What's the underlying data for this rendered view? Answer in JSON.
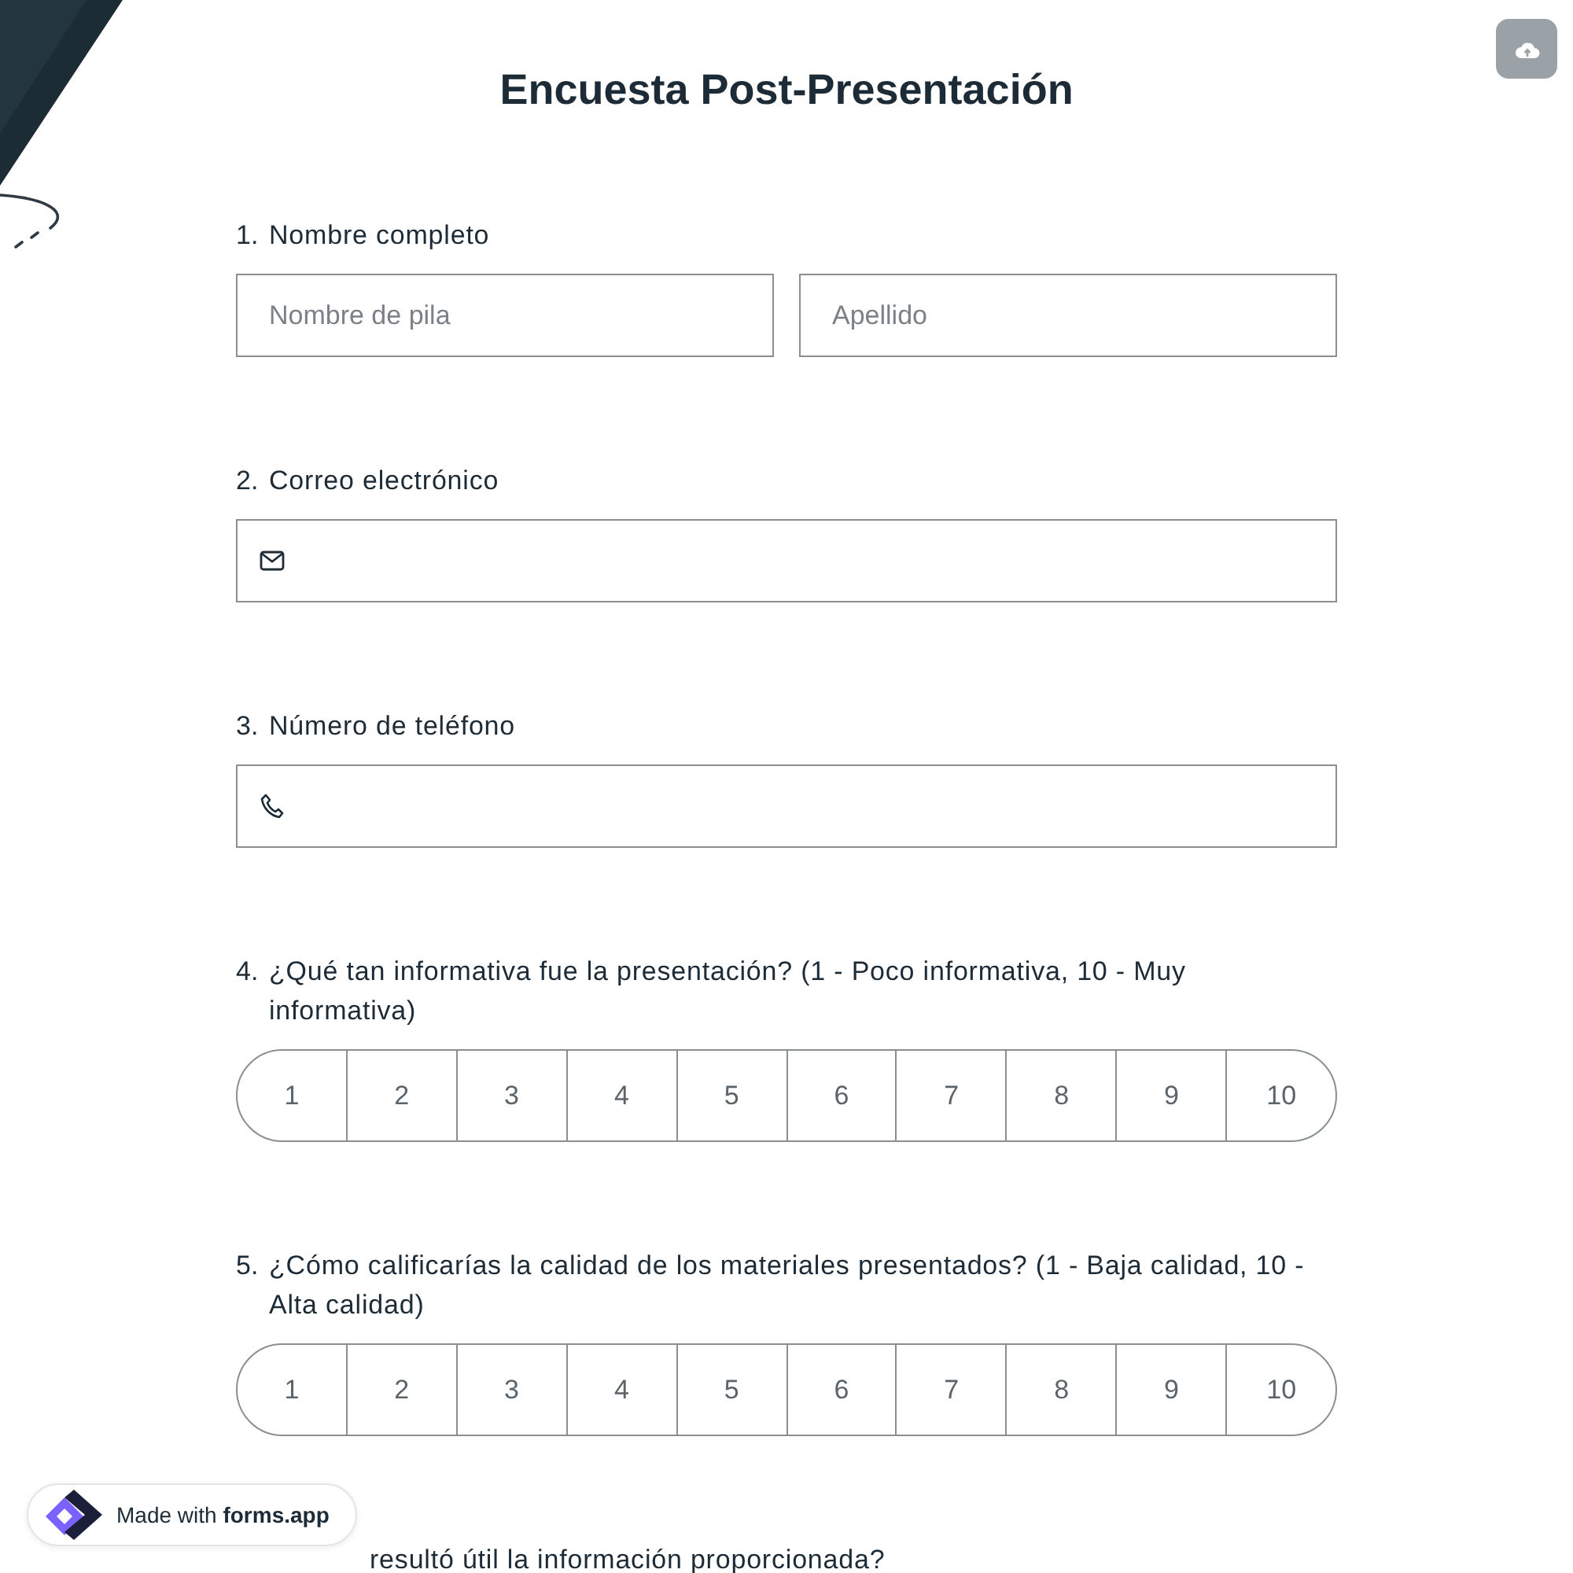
{
  "title": "Encuesta Post-Presentación",
  "questions": [
    {
      "number": "1.",
      "label": "Nombre completo",
      "kind": "name",
      "fields": [
        {
          "placeholder": "Nombre de pila"
        },
        {
          "placeholder": "Apellido"
        }
      ]
    },
    {
      "number": "2.",
      "label": "Correo electrónico",
      "kind": "email"
    },
    {
      "number": "3.",
      "label": "Número de teléfono",
      "kind": "phone"
    },
    {
      "number": "4.",
      "label": "¿Qué tan informativa fue la presentación? (1 - Poco informativa, 10 - Muy informativa)",
      "kind": "scale",
      "options": [
        "1",
        "2",
        "3",
        "4",
        "5",
        "6",
        "7",
        "8",
        "9",
        "10"
      ]
    },
    {
      "number": "5.",
      "label": "¿Cómo calificarías la calidad de los materiales presentados? (1 - Baja calidad, 10 - Alta calidad)",
      "kind": "scale",
      "options": [
        "1",
        "2",
        "3",
        "4",
        "5",
        "6",
        "7",
        "8",
        "9",
        "10"
      ]
    },
    {
      "label": "resultó útil la información proporcionada?",
      "kind": "partial"
    }
  ],
  "badge": {
    "prefix": "Made with",
    "brand": "forms.app"
  }
}
